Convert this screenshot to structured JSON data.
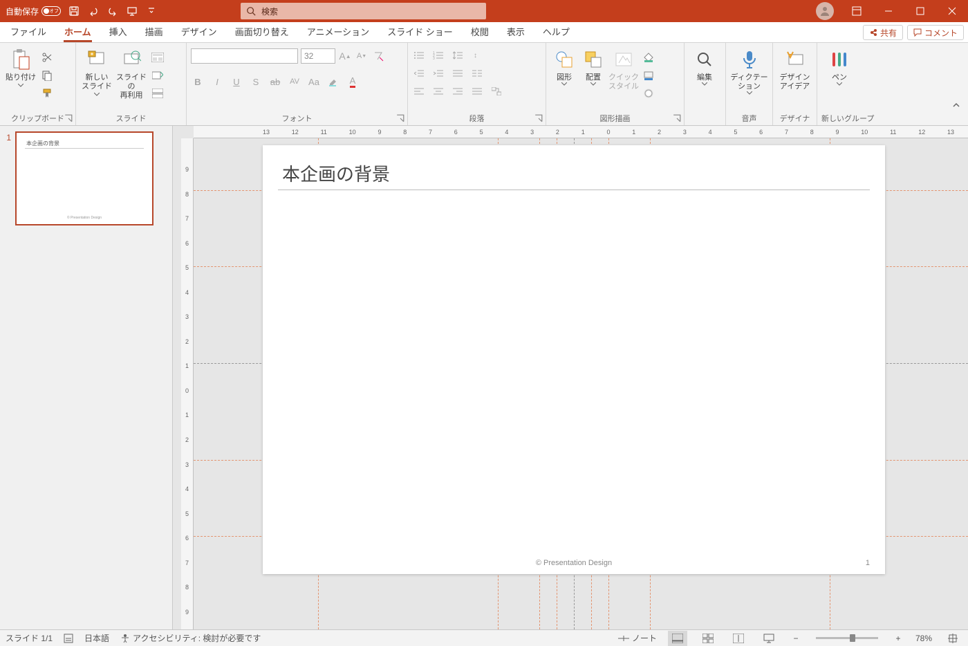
{
  "titlebar": {
    "autosave_label": "自動保存",
    "autosave_state": "オフ",
    "search_placeholder": "検索"
  },
  "tabs": {
    "file": "ファイル",
    "home": "ホーム",
    "insert": "挿入",
    "draw": "描画",
    "design": "デザイン",
    "transitions": "画面切り替え",
    "animations": "アニメーション",
    "slideshow": "スライド ショー",
    "review": "校閲",
    "view": "表示",
    "help": "ヘルプ",
    "share": "共有",
    "comments": "コメント"
  },
  "ribbon": {
    "clipboard_group": "クリップボード",
    "paste": "貼り付け",
    "slides_group": "スライド",
    "new_slide": "新しい\nスライド",
    "reuse_slides": "スライドの\n再利用",
    "font_group": "フォント",
    "font_name": "",
    "font_size": "32",
    "paragraph_group": "段落",
    "drawing_group": "図形描画",
    "shapes": "図形",
    "arrange": "配置",
    "quick_styles": "クイック\nスタイル",
    "editing": "編集",
    "voice_group": "音声",
    "dictation": "ディクテー\nション",
    "designer_group": "デザイナー",
    "design_ideas": "デザイン\nアイデア",
    "new_group": "新しいグループ",
    "pen": "ペン"
  },
  "thumbnail": {
    "number": "1",
    "title": "本企画の背景",
    "footer": "© Presentation Design"
  },
  "slide": {
    "title": "本企画の背景",
    "footer": "© Presentation Design",
    "page_number": "1"
  },
  "ruler": {
    "h_ticks": [
      "13",
      "12",
      "11",
      "10",
      "9",
      "8",
      "7",
      "6",
      "5",
      "4",
      "3",
      "2",
      "1",
      "0",
      "1",
      "2",
      "3",
      "4",
      "5",
      "6",
      "7",
      "8",
      "9",
      "10",
      "11",
      "12",
      "13"
    ],
    "v_ticks": [
      "9",
      "8",
      "7",
      "6",
      "5",
      "4",
      "3",
      "2",
      "1",
      "0",
      "1",
      "2",
      "3",
      "4",
      "5",
      "6",
      "7",
      "8",
      "9"
    ]
  },
  "statusbar": {
    "slide_indicator": "スライド 1/1",
    "language": "日本語",
    "accessibility": "アクセシビリティ: 検討が必要です",
    "notes": "ノート",
    "zoom_level": "78%"
  }
}
